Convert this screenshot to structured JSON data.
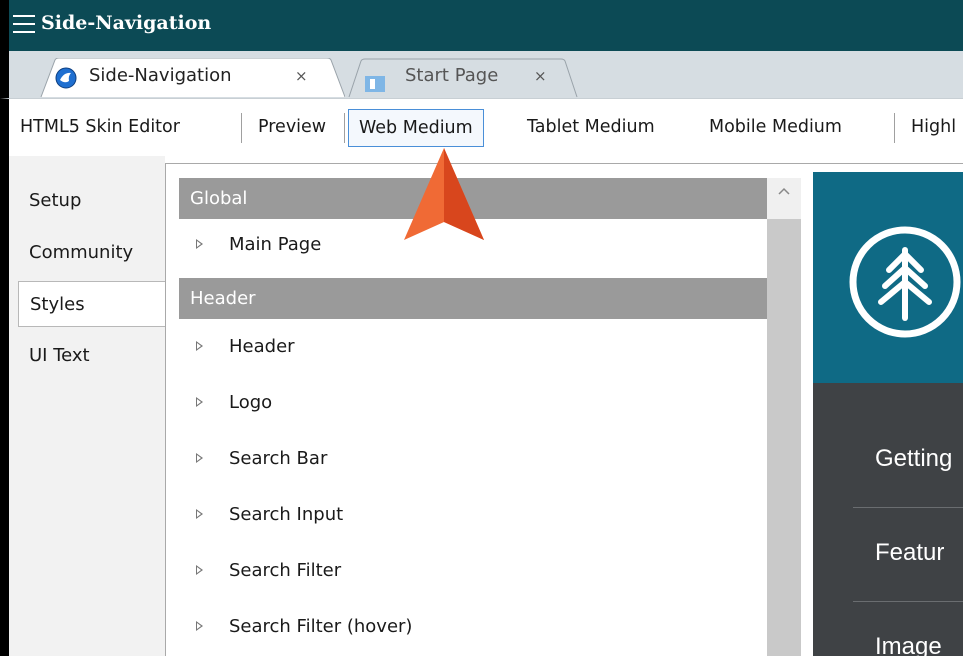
{
  "window": {
    "title": "Side-Navigation"
  },
  "tabs": [
    {
      "label": "Side-Navigation",
      "close": "×",
      "active": true
    },
    {
      "label": "Start Page",
      "close": "×",
      "active": false
    }
  ],
  "toolbar": {
    "items": [
      "HTML5 Skin Editor",
      "Preview",
      "Web Medium",
      "Tablet Medium",
      "Mobile Medium",
      "Highl"
    ],
    "selected": "Web Medium"
  },
  "side_tabs": [
    "Setup",
    "Community",
    "Styles",
    "UI Text"
  ],
  "active_side_tab": "Styles",
  "style_groups": [
    {
      "name": "Global",
      "items": [
        "Main Page"
      ]
    },
    {
      "name": "Header",
      "items": [
        "Header",
        "Logo",
        "Search Bar",
        "Search Input",
        "Search Filter",
        "Search Filter (hover)"
      ]
    }
  ],
  "preview": {
    "menu_items": [
      "Getting",
      "Featur",
      "Image"
    ],
    "header_color": "#0f6a85",
    "menu_color": "#3f4245"
  },
  "colors": {
    "titlebar": "#0c4a55",
    "callout": "#e8532a",
    "selection_border": "#4a8fd8"
  }
}
